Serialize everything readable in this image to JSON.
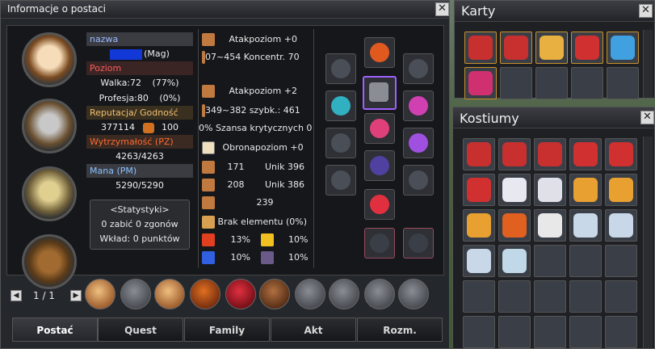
{
  "main": {
    "title": "Informacje o postaci",
    "stats": {
      "name_label": "nazwa",
      "class_text": "(Mag)",
      "level_label": "Poziom",
      "combat_level": "Walka:72",
      "combat_pct": "(77%)",
      "job_level": "Profesja:80",
      "job_pct": "(0%)",
      "reputation_label": "Reputacja/ Godność",
      "reputation_value": "377114",
      "dignity_value": "100",
      "hp_label": "Wytrzymałość (PZ)",
      "hp_value": "4263/4263",
      "mp_label": "Mana (PM)",
      "mp_value": "5290/5290",
      "stats_button": "<Statystyki>",
      "kills_text": "0 zabić 0 zgonów",
      "contribution_text": "Wkład: 0 punktów"
    },
    "equip": {
      "atk1_label": "Atakpoziom +0",
      "atk1_range": "07~454 Koncentr. 70",
      "atk2_label": "Atakpoziom +2",
      "atk2_range": "349~382 szybk.: 461",
      "crit_text": "0% Szansa krytycznych  0",
      "def_label": "Obronapoziom +0",
      "melee_def": "171",
      "melee_dodge": "Unik 396",
      "ranged_def": "208",
      "ranged_dodge": "Unik 386",
      "magic_def": "239",
      "element_text": "Brak elementu (0%)",
      "fire_res": "13%",
      "light_res": "10%",
      "water_res": "10%",
      "dark_res": "10%"
    },
    "pager": "1 / 1",
    "tabs": [
      "Postać",
      "Quest",
      "Family",
      "Akt",
      "Rozm."
    ]
  },
  "karty": {
    "title": "Karty"
  },
  "kostiumy": {
    "title": "Kostiumy"
  },
  "close_glyph": "✕",
  "colors": {
    "window_bg": "#24272c",
    "selected_slot": "#a060ff",
    "name_highlight": "#1238d8"
  }
}
